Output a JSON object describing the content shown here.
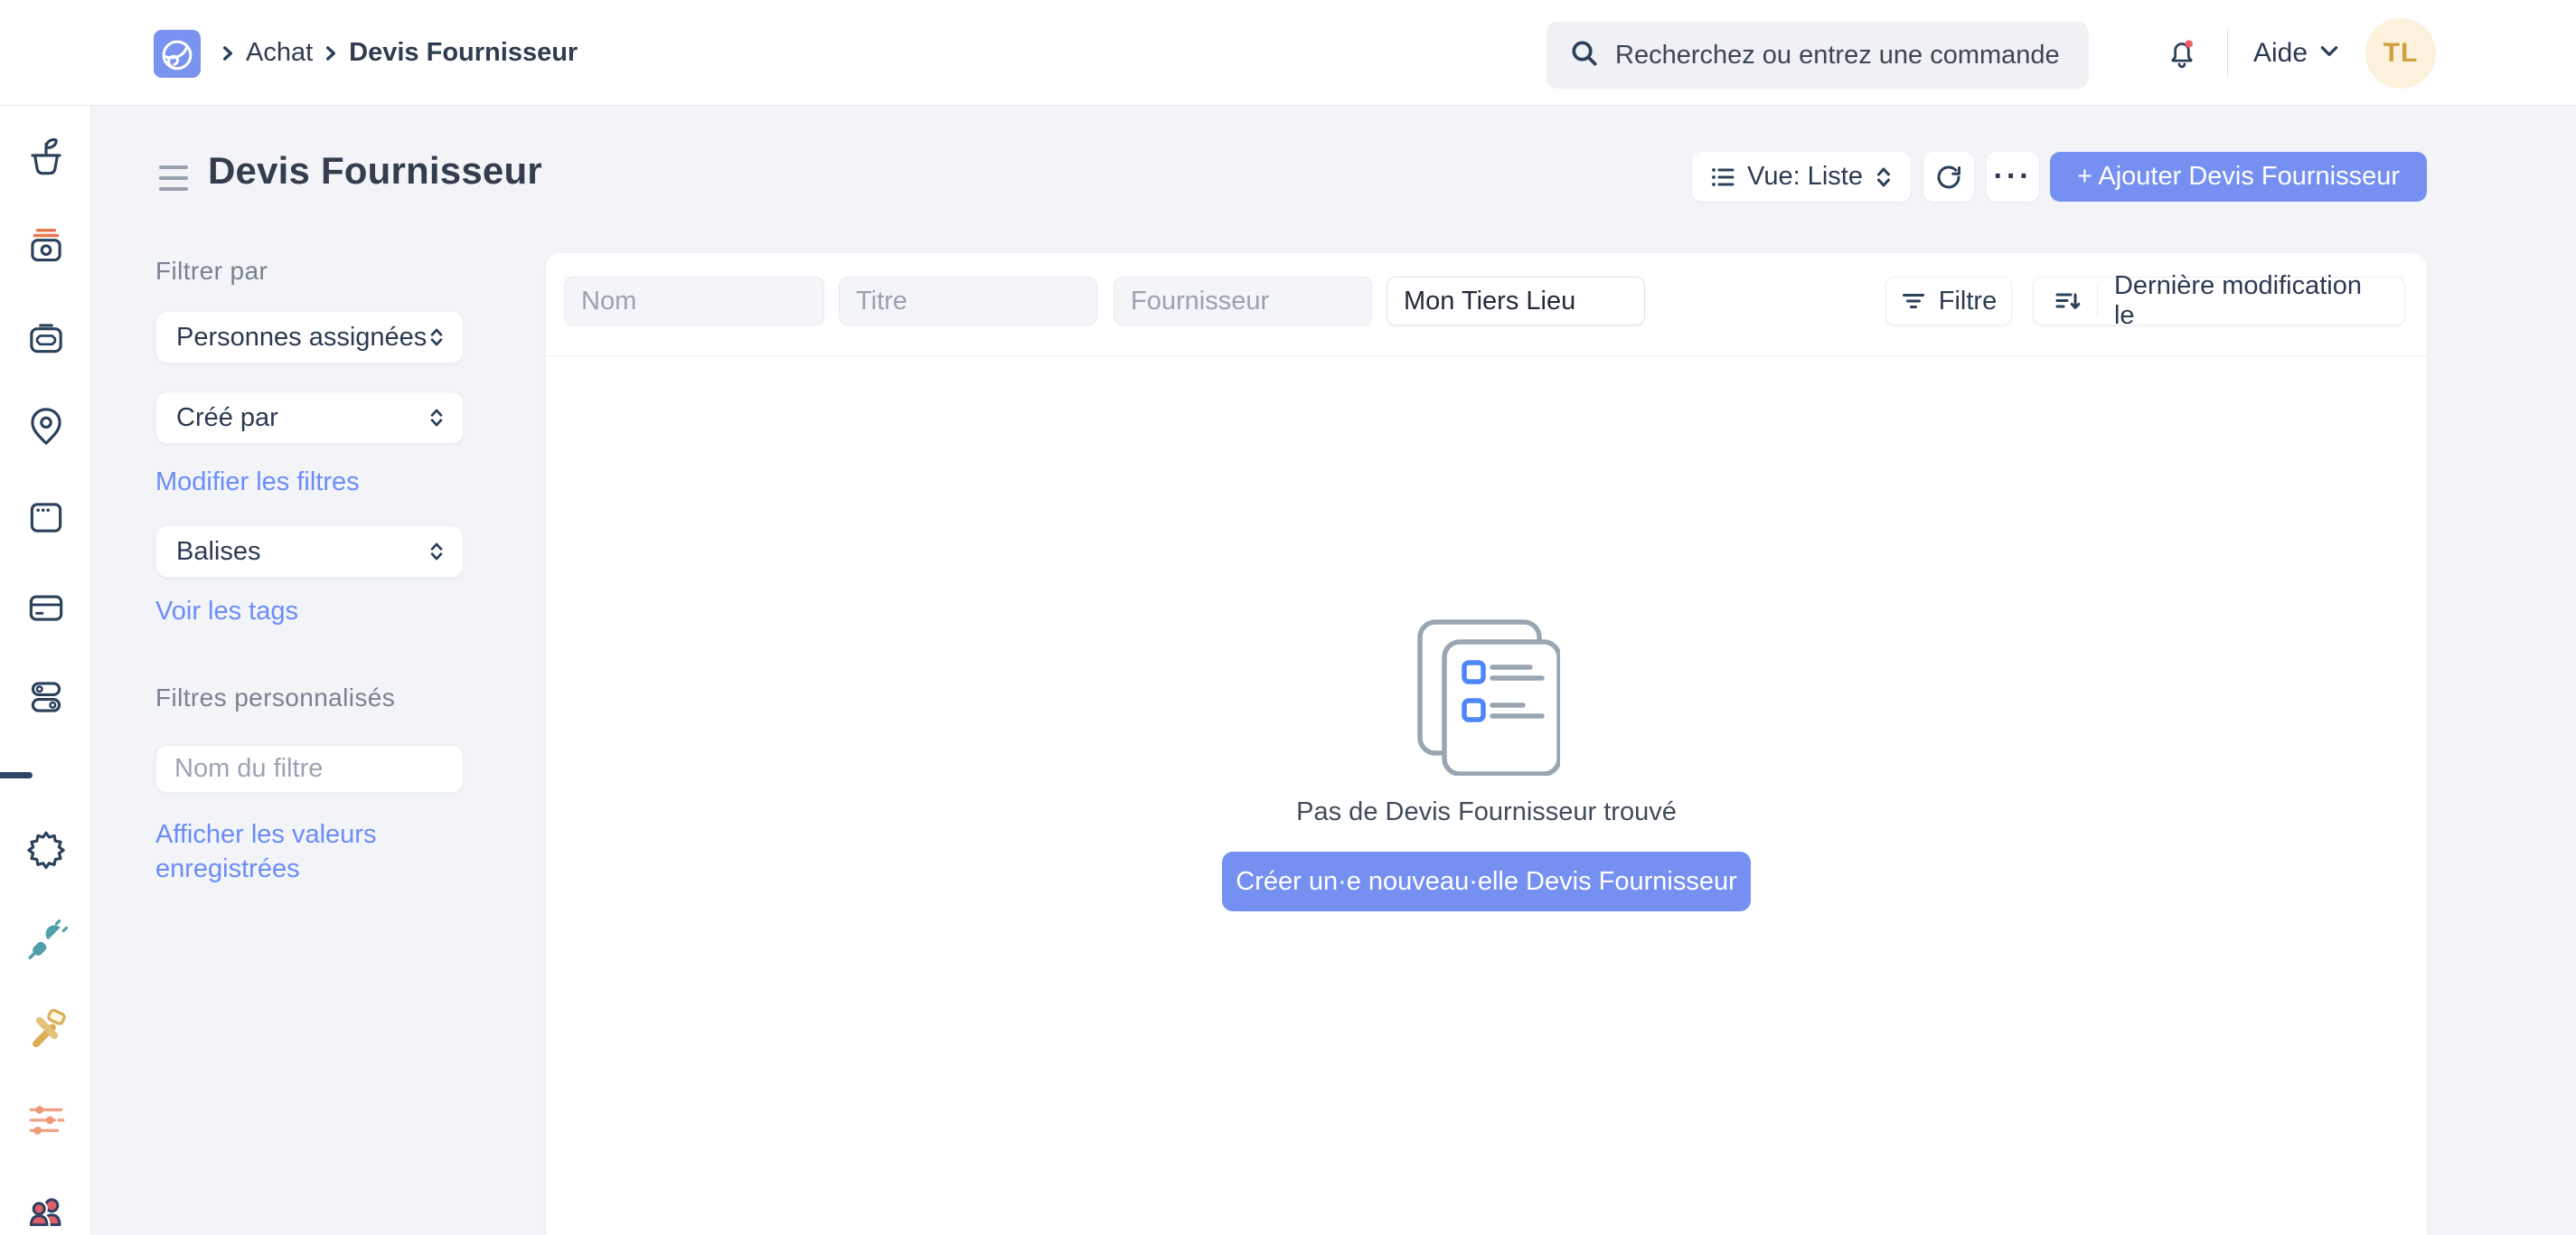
{
  "colors": {
    "accent_button": "#7590f1",
    "link": "#6c8cf8",
    "navy_text": "#2b3a52",
    "title_text": "#333d4e",
    "muted_label": "#78828f",
    "placeholder": "#9aa4b2",
    "page_bg": "#f2f4f8",
    "card_bg": "#ffffff",
    "avatar_bg": "#fcf1dd",
    "avatar_text": "#cfa13d",
    "notification_dot": "#ee5d62",
    "empty_icon_gray": "#9aa5b2",
    "empty_icon_blue": "#4c86f7",
    "sidebar_divider": "#2d4467"
  },
  "topbar": {
    "logo_icon": "app-logo-icon",
    "breadcrumb": {
      "items": [
        "Achat",
        "Devis Fournisseur"
      ]
    },
    "search": {
      "placeholder": "Recherchez ou entrez une commande",
      "icon": "search-icon"
    },
    "notifications_icon": "bell-icon",
    "help_label": "Aide",
    "avatar_initials": "TL"
  },
  "sidebar": {
    "icons": [
      {
        "name": "plant-pot-icon",
        "color": "#f2c469"
      },
      {
        "name": "camera-icon",
        "color": "#df6b4c"
      },
      {
        "name": "briefcase-icon",
        "color": "#3f5d84"
      },
      {
        "name": "map-pin-icon",
        "color": "#f2c469"
      },
      {
        "name": "browser-window-icon",
        "color": "#93b9ce"
      },
      {
        "name": "bank-card-icon",
        "color": "#4da089"
      },
      {
        "name": "toggles-icon",
        "color": "#7b97f5"
      },
      {
        "name": "gear-icon",
        "color": "#6f8ff2"
      },
      {
        "name": "plug-icon",
        "color": "#4f9fa9"
      },
      {
        "name": "tools-icon",
        "color": "#e4c277"
      },
      {
        "name": "sliders-icon",
        "color": "#f2a185"
      },
      {
        "name": "people-icon",
        "color": "#dd5f67"
      }
    ]
  },
  "page": {
    "title": "Devis Fournisseur",
    "toolbar": {
      "view_label": "Vue: Liste",
      "refresh_icon": "refresh-icon",
      "more_label": "···",
      "add_label": "+ Ajouter Devis Fournisseur"
    }
  },
  "filter_panel": {
    "filter_by_label": "Filtrer par",
    "assignees_dropdown": "Personnes assignées",
    "created_by_dropdown": "Créé par",
    "edit_filters_link": "Modifier les filtres",
    "tags_dropdown": "Balises",
    "see_tags_link": "Voir les tags",
    "custom_filters_label": "Filtres personnalisés",
    "filter_name_placeholder": "Nom du filtre",
    "saved_values_link": "Afficher les valeurs enregistrées"
  },
  "list_area": {
    "quick_filters": [
      {
        "placeholder": "Nom",
        "value": ""
      },
      {
        "placeholder": "Titre",
        "value": ""
      },
      {
        "placeholder": "Fournisseur",
        "value": ""
      },
      {
        "placeholder": "",
        "value": "Mon Tiers Lieu"
      }
    ],
    "filter_button": "Filtre",
    "sort_button": "Dernière modification le",
    "empty_state": {
      "message": "Pas de Devis Fournisseur trouvé",
      "create_button": "Créer un·e nouveau·elle Devis Fournisseur"
    }
  }
}
